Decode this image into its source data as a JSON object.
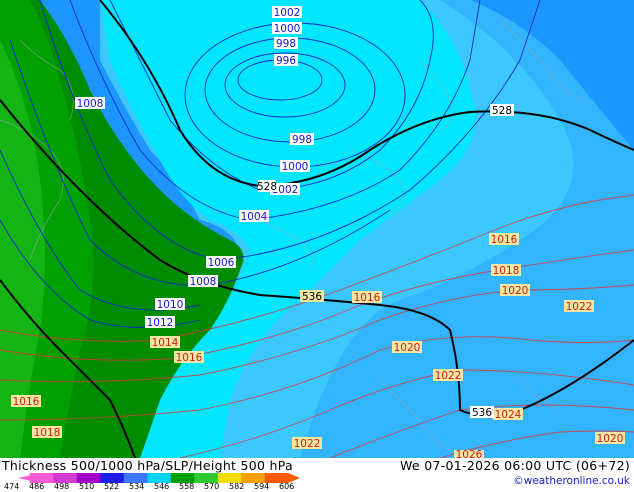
{
  "map": {
    "isobar_labels": [
      {
        "text": "1002",
        "color": "blue"
      },
      {
        "text": "1000",
        "color": "blue"
      },
      {
        "text": "998",
        "color": "blue"
      },
      {
        "text": "996",
        "color": "blue"
      },
      {
        "text": "1008",
        "color": "blue"
      },
      {
        "text": "998",
        "color": "blue"
      },
      {
        "text": "1000",
        "color": "blue"
      },
      {
        "text": "1002",
        "color": "blue"
      },
      {
        "text": "1004",
        "color": "blue"
      },
      {
        "text": "1006",
        "color": "blue"
      },
      {
        "text": "1008",
        "color": "blue"
      },
      {
        "text": "1010",
        "color": "blue"
      },
      {
        "text": "1012",
        "color": "blue"
      },
      {
        "text": "1014",
        "color": "red"
      },
      {
        "text": "1016",
        "color": "red"
      },
      {
        "text": "1016",
        "color": "red"
      },
      {
        "text": "1016",
        "color": "red"
      },
      {
        "text": "1016",
        "color": "red"
      },
      {
        "text": "1018",
        "color": "red"
      },
      {
        "text": "1018",
        "color": "red"
      },
      {
        "text": "1020",
        "color": "red"
      },
      {
        "text": "1020",
        "color": "red"
      },
      {
        "text": "1020",
        "color": "red"
      },
      {
        "text": "1022",
        "color": "red"
      },
      {
        "text": "1022",
        "color": "red"
      },
      {
        "text": "1022",
        "color": "red"
      },
      {
        "text": "1024",
        "color": "red"
      },
      {
        "text": "1026",
        "color": "red"
      }
    ],
    "height_labels": [
      "528",
      "528",
      "536",
      "536"
    ]
  },
  "footer": {
    "title": "Thickness 500/1000 hPa/SLP/Height 500 hPa",
    "datetime": "We 07-01-2026 06:00 UTC (06+72)",
    "credit": "©weatheronline.co.uk",
    "scale_values": [
      "474",
      "486",
      "498",
      "510",
      "522",
      "534",
      "546",
      "558",
      "570",
      "582",
      "594",
      "606"
    ],
    "scale_colors": [
      "#ff5ad2",
      "#d23cd2",
      "#a000c8",
      "#1e1ee6",
      "#3c78ff",
      "#00d2ff",
      "#00a000",
      "#32c832",
      "#f0dc00",
      "#ffa000",
      "#ff5a00"
    ]
  }
}
